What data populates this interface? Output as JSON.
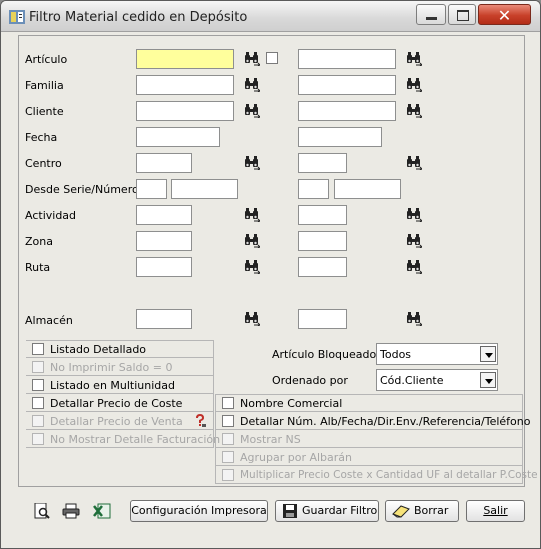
{
  "window": {
    "title": "Filtro Material cedido en Depósito",
    "close_glyph": "✕"
  },
  "fields": {
    "articulo": "Artículo",
    "familia": "Familia",
    "cliente": "Cliente",
    "fecha": "Fecha",
    "centro": "Centro",
    "desde_serie": "Desde Serie/Número",
    "actividad": "Actividad",
    "zona": "Zona",
    "ruta": "Ruta",
    "almacen": "Almacén"
  },
  "options_left": [
    {
      "label": "Listado Detallado",
      "checked": false,
      "enabled": true
    },
    {
      "label": "No Imprimir Saldo = 0",
      "checked": false,
      "enabled": false
    },
    {
      "label": "Listado en Multiunidad",
      "checked": false,
      "enabled": true
    },
    {
      "label": "Detallar Precio de Coste",
      "checked": false,
      "enabled": true
    },
    {
      "label": "Detallar Precio de Venta",
      "checked": false,
      "enabled": false
    },
    {
      "label": "No Mostrar Detalle Facturación",
      "checked": false,
      "enabled": false
    }
  ],
  "options_right": [
    {
      "label": "Nombre Comercial",
      "checked": false,
      "enabled": true
    },
    {
      "label": "Detallar Núm. Alb/Fecha/Dir.Env./Referencia/Teléfono",
      "checked": false,
      "enabled": true
    },
    {
      "label": "Mostrar NS",
      "checked": false,
      "enabled": false
    },
    {
      "label": "Agrupar por Albarán",
      "checked": false,
      "enabled": false
    },
    {
      "label": "Multiplicar Precio Coste x Cantidad UF al detallar P.Coste",
      "checked": false,
      "enabled": false
    }
  ],
  "selects": {
    "articulo_bloqueado": {
      "label": "Artículo Bloqueado",
      "value": "Todos"
    },
    "ordenado_por": {
      "label": "Ordenado por",
      "value": "Cód.Cliente"
    }
  },
  "buttons": {
    "config": "Configuración Impresora",
    "guardar": "Guardar Filtro",
    "borrar": "Borrar",
    "salir": "Salir"
  },
  "icons": {
    "app": "app-icon",
    "finder": "binoculars-icon",
    "preview": "print-preview-icon",
    "print": "printer-icon",
    "excel": "excel-export-icon",
    "help": "question-icon",
    "save": "floppy-icon",
    "eraser": "eraser-icon"
  },
  "colors": {
    "required_field": "#ffff9c",
    "close_button": "#c8412a"
  }
}
